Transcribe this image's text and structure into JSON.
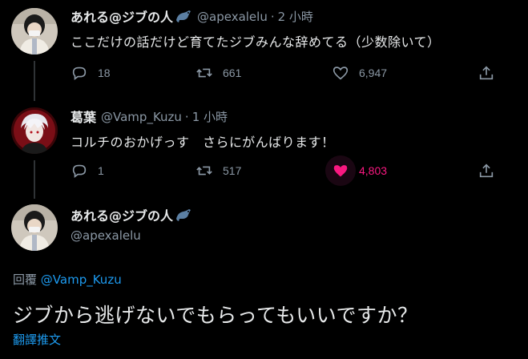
{
  "tweets": [
    {
      "name": "あれる@ジブの人",
      "handle": "@apexalelu",
      "dot": "·",
      "time": "2 小時",
      "text": "ここだけの話だけど育てたジブみんな辞めてる（少数除いて）",
      "replies": "18",
      "retweets": "661",
      "likes": "6,947"
    },
    {
      "name": "葛葉",
      "handle": "@Vamp_Kuzu",
      "dot": "·",
      "time": "1 小時",
      "text": "コルチのおかげっす　さらにがんばります！",
      "replies": "1",
      "retweets": "517",
      "likes": "4,803"
    }
  ],
  "focus": {
    "name": "あれる@ジブの人",
    "handle": "@apexalelu",
    "reply_prefix": "回覆",
    "reply_to": "@Vamp_Kuzu",
    "text": "ジブから逃げないでもらってもいいですか？",
    "translate": "翻譯推文"
  },
  "colors": {
    "background": "#000000",
    "link": "#1d9bf0",
    "like_active": "#f91880",
    "muted": "#8b98a5"
  },
  "icons": [
    "reply-icon",
    "retweet-icon",
    "like-icon",
    "share-icon",
    "seal-emoji-icon"
  ]
}
